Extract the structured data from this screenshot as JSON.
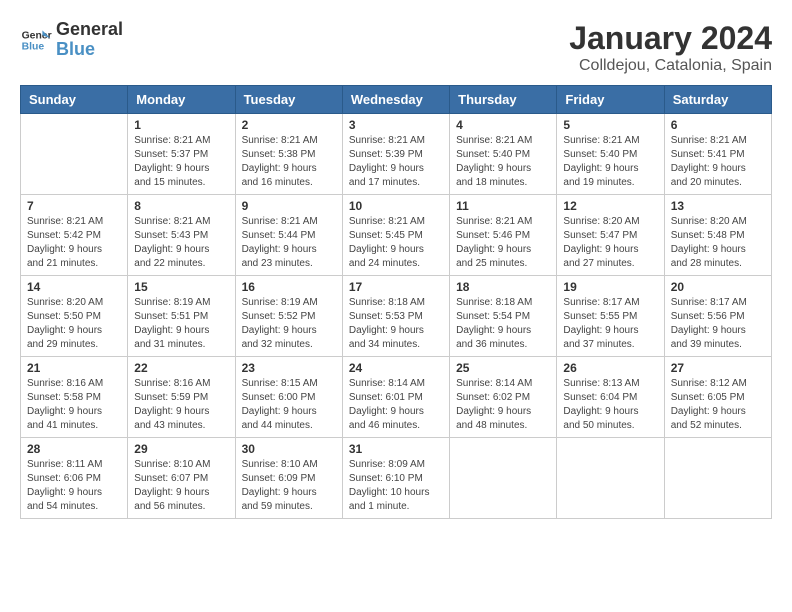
{
  "header": {
    "logo_line1": "General",
    "logo_line2": "Blue",
    "title": "January 2024",
    "subtitle": "Colldejou, Catalonia, Spain"
  },
  "weekdays": [
    "Sunday",
    "Monday",
    "Tuesday",
    "Wednesday",
    "Thursday",
    "Friday",
    "Saturday"
  ],
  "weeks": [
    [
      {
        "day": "",
        "info": ""
      },
      {
        "day": "1",
        "info": "Sunrise: 8:21 AM\nSunset: 5:37 PM\nDaylight: 9 hours\nand 15 minutes."
      },
      {
        "day": "2",
        "info": "Sunrise: 8:21 AM\nSunset: 5:38 PM\nDaylight: 9 hours\nand 16 minutes."
      },
      {
        "day": "3",
        "info": "Sunrise: 8:21 AM\nSunset: 5:39 PM\nDaylight: 9 hours\nand 17 minutes."
      },
      {
        "day": "4",
        "info": "Sunrise: 8:21 AM\nSunset: 5:40 PM\nDaylight: 9 hours\nand 18 minutes."
      },
      {
        "day": "5",
        "info": "Sunrise: 8:21 AM\nSunset: 5:40 PM\nDaylight: 9 hours\nand 19 minutes."
      },
      {
        "day": "6",
        "info": "Sunrise: 8:21 AM\nSunset: 5:41 PM\nDaylight: 9 hours\nand 20 minutes."
      }
    ],
    [
      {
        "day": "7",
        "info": "Sunrise: 8:21 AM\nSunset: 5:42 PM\nDaylight: 9 hours\nand 21 minutes."
      },
      {
        "day": "8",
        "info": "Sunrise: 8:21 AM\nSunset: 5:43 PM\nDaylight: 9 hours\nand 22 minutes."
      },
      {
        "day": "9",
        "info": "Sunrise: 8:21 AM\nSunset: 5:44 PM\nDaylight: 9 hours\nand 23 minutes."
      },
      {
        "day": "10",
        "info": "Sunrise: 8:21 AM\nSunset: 5:45 PM\nDaylight: 9 hours\nand 24 minutes."
      },
      {
        "day": "11",
        "info": "Sunrise: 8:21 AM\nSunset: 5:46 PM\nDaylight: 9 hours\nand 25 minutes."
      },
      {
        "day": "12",
        "info": "Sunrise: 8:20 AM\nSunset: 5:47 PM\nDaylight: 9 hours\nand 27 minutes."
      },
      {
        "day": "13",
        "info": "Sunrise: 8:20 AM\nSunset: 5:48 PM\nDaylight: 9 hours\nand 28 minutes."
      }
    ],
    [
      {
        "day": "14",
        "info": "Sunrise: 8:20 AM\nSunset: 5:50 PM\nDaylight: 9 hours\nand 29 minutes."
      },
      {
        "day": "15",
        "info": "Sunrise: 8:19 AM\nSunset: 5:51 PM\nDaylight: 9 hours\nand 31 minutes."
      },
      {
        "day": "16",
        "info": "Sunrise: 8:19 AM\nSunset: 5:52 PM\nDaylight: 9 hours\nand 32 minutes."
      },
      {
        "day": "17",
        "info": "Sunrise: 8:18 AM\nSunset: 5:53 PM\nDaylight: 9 hours\nand 34 minutes."
      },
      {
        "day": "18",
        "info": "Sunrise: 8:18 AM\nSunset: 5:54 PM\nDaylight: 9 hours\nand 36 minutes."
      },
      {
        "day": "19",
        "info": "Sunrise: 8:17 AM\nSunset: 5:55 PM\nDaylight: 9 hours\nand 37 minutes."
      },
      {
        "day": "20",
        "info": "Sunrise: 8:17 AM\nSunset: 5:56 PM\nDaylight: 9 hours\nand 39 minutes."
      }
    ],
    [
      {
        "day": "21",
        "info": "Sunrise: 8:16 AM\nSunset: 5:58 PM\nDaylight: 9 hours\nand 41 minutes."
      },
      {
        "day": "22",
        "info": "Sunrise: 8:16 AM\nSunset: 5:59 PM\nDaylight: 9 hours\nand 43 minutes."
      },
      {
        "day": "23",
        "info": "Sunrise: 8:15 AM\nSunset: 6:00 PM\nDaylight: 9 hours\nand 44 minutes."
      },
      {
        "day": "24",
        "info": "Sunrise: 8:14 AM\nSunset: 6:01 PM\nDaylight: 9 hours\nand 46 minutes."
      },
      {
        "day": "25",
        "info": "Sunrise: 8:14 AM\nSunset: 6:02 PM\nDaylight: 9 hours\nand 48 minutes."
      },
      {
        "day": "26",
        "info": "Sunrise: 8:13 AM\nSunset: 6:04 PM\nDaylight: 9 hours\nand 50 minutes."
      },
      {
        "day": "27",
        "info": "Sunrise: 8:12 AM\nSunset: 6:05 PM\nDaylight: 9 hours\nand 52 minutes."
      }
    ],
    [
      {
        "day": "28",
        "info": "Sunrise: 8:11 AM\nSunset: 6:06 PM\nDaylight: 9 hours\nand 54 minutes."
      },
      {
        "day": "29",
        "info": "Sunrise: 8:10 AM\nSunset: 6:07 PM\nDaylight: 9 hours\nand 56 minutes."
      },
      {
        "day": "30",
        "info": "Sunrise: 8:10 AM\nSunset: 6:09 PM\nDaylight: 9 hours\nand 59 minutes."
      },
      {
        "day": "31",
        "info": "Sunrise: 8:09 AM\nSunset: 6:10 PM\nDaylight: 10 hours\nand 1 minute."
      },
      {
        "day": "",
        "info": ""
      },
      {
        "day": "",
        "info": ""
      },
      {
        "day": "",
        "info": ""
      }
    ]
  ]
}
